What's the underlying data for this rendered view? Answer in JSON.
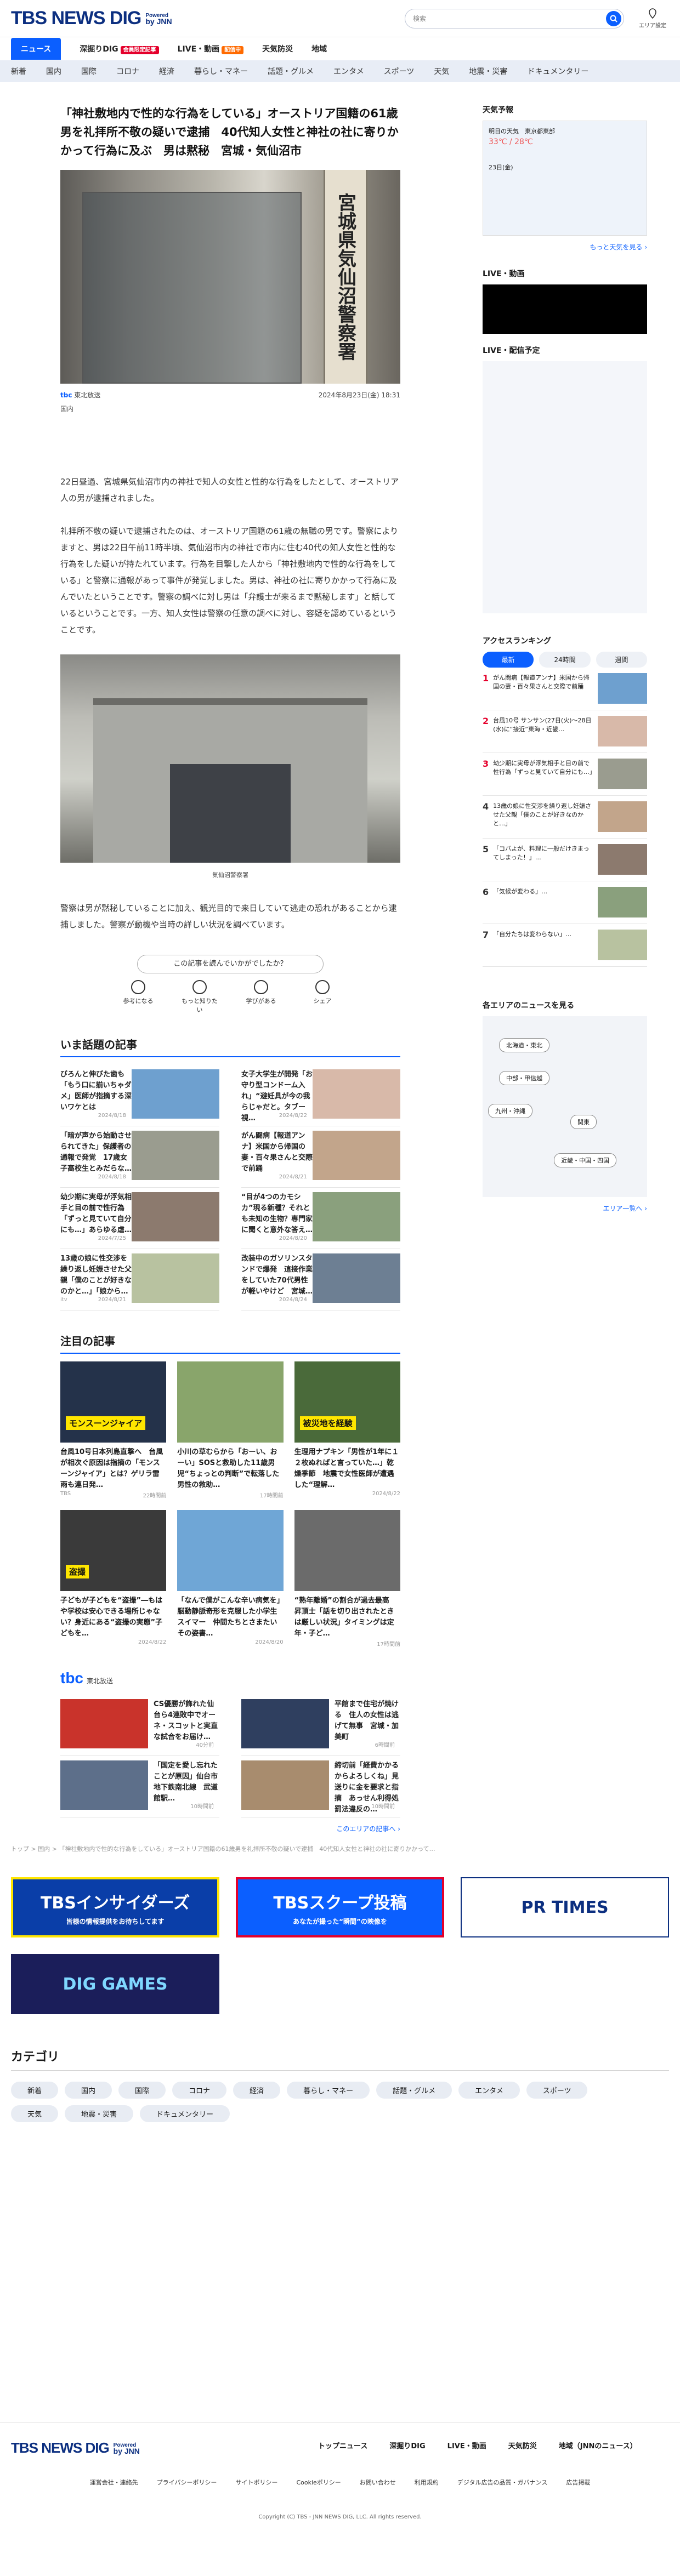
{
  "header": {
    "logo": "TBS NEWS DIG",
    "powered": "Powered",
    "powered_by": "by JNN",
    "search_placeholder": "検索",
    "area_label": "エリア設定"
  },
  "nav": {
    "items": [
      {
        "label": "ニュース",
        "tag": ""
      },
      {
        "label": "深掘りDIG",
        "tag": "会員限定記事"
      },
      {
        "label": "LIVE・動画",
        "tag": "配信中"
      },
      {
        "label": "天気防災",
        "tag": ""
      },
      {
        "label": "地域",
        "tag": ""
      }
    ]
  },
  "subnav": [
    "新着",
    "国内",
    "国際",
    "コロナ",
    "経済",
    "暮らし・マネー",
    "話題・グルメ",
    "エンタメ",
    "スポーツ",
    "天気",
    "地震・災害",
    "ドキュメンタリー"
  ],
  "article": {
    "title": "「神社敷地内で性的な行為をしている」オーストリア国籍の61歳男を礼拝所不敬の疑いで逮捕　40代知人女性と神社の社に寄りかかって行為に及ぶ　男は黙秘　宮城・気仙沼市",
    "sign_text": "宮城県気仙沼警察署",
    "source": "東北放送",
    "date": "2024年8月23日(金) 18:31",
    "category": "国内",
    "paragraphs": [
      "22日昼過、宮城県気仙沼市内の神社で知人の女性と性的な行為をしたとして、オーストリア人の男が逮捕されました。",
      "礼拝所不敬の疑いで逮捕されたのは、オーストリア国籍の61歳の無職の男です。警察によりますと、男は22日午前11時半頃、気仙沼市内の神社で市内に住む40代の知人女性と性的な行為をした疑いが持たれています。行為を目撃した人から「神社敷地内で性的な行為をしている」と警察に通報があって事件が発覚しました。男は、神社の社に寄りかかって行為に及んでいたということです。警察の調べに対し男は「弁護士が来るまで黙秘します」と話しているということです。一方、知人女性は警察の任意の調べに対し、容疑を認めているということです。",
      "警察は男が黙秘していることに加え、観光目的で来日していて逃走の恐れがあることから逮捕しました。警察が動機や当時の詳しい状況を調べています。"
    ],
    "photo2_caption": "気仙沼警察署"
  },
  "feedback": {
    "question": "この記事を読んでいかがでしたか？",
    "options": [
      "参考になる",
      "もっと知りたい",
      "学びがある",
      "シェア"
    ]
  },
  "trending": {
    "title": "いま話題の記事",
    "items": [
      {
        "text": "びろんと伸びた歯も「もう口に揃いちゃダメ」医師が指摘する深いワケとは",
        "src": "",
        "date": "2024/8/18"
      },
      {
        "text": "女子大学生が開発「お守り型コンドーム入れ」“避妊具が今の我らじゃだと。タブー視…",
        "src": "",
        "date": "2024/8/22"
      },
      {
        "text": "「暗が声から始動させられてきた」保護者の通報で発覚　17歳女子高校生とみだらな…",
        "src": "",
        "date": "2024/8/18"
      },
      {
        "text": "がん闘病【報道アンナ】米国から帰国の妻・百々果さんと交際で前踊",
        "src": "",
        "date": "2024/8/21"
      },
      {
        "text": "幼少期に実母が浮気相手と目の前で性行為「ずっと見ていて自分にも…」あらゆる虐…",
        "src": "",
        "date": "2024/7/25"
      },
      {
        "text": "“目が4つのカモシカ”現る新種？それとも未知の生物？専門家に聞くと意外な答え…",
        "src": "",
        "date": "2024/8/20"
      },
      {
        "text": "13歳の娘に性交渉を繰り返し妊娠させた父親「僕のことが好きなのかと…」「娘から…",
        "src": "itv",
        "date": "2024/8/21"
      },
      {
        "text": "改装中のガソリンスタンドで爆発　這接作業をしていた70代男性が軽いやけど　宮城…",
        "src": "",
        "date": "2024/8/24"
      }
    ]
  },
  "featured": {
    "title": "注目の記事",
    "items": [
      {
        "text": "台風10号日本列島直撃へ　台風が相次ぐ原因は指摘の「モンスーンジャイア」とは？ゲリラ雷雨も連日発…",
        "src": "TBS",
        "date": "22時間前",
        "img_text": "モンスーンジャイア"
      },
      {
        "text": "小川の草むらから「おーい、おーい」SOSと救助した11歳男児“ちょっとの判断”で転落した男性の救助…",
        "src": "",
        "date": "17時間前"
      },
      {
        "text": "生理用ナプキン「男性が1年に１２枚ぬればと言っていた…」乾燥季節　地震で女性医師が遭遇した“理解…",
        "src": "",
        "date": "2024/8/22",
        "img_text": "被災地を経験"
      },
      {
        "text": "子どもが子どもを“盗撮”―もはや学校は安心できる場所じゃない？身近にある“盗撮の実態”子どもを…",
        "src": "",
        "date": "2024/8/22",
        "img_text": "盗撮"
      },
      {
        "text": "「なんで僕がこんな辛い病気を」脳動静脈奇形を克服した小学生スイマー　仲間たちとさまたいその姿書…",
        "src": "",
        "date": "2024/8/20"
      },
      {
        "text": "“熟年離婚”の割合が過去最高　昇頂士「話を切り出されたときは厳しい状況」タイミングは定年・子ど…",
        "src": "",
        "date": "17時間前"
      }
    ]
  },
  "tbc": {
    "logo": "tbc",
    "label": "東北放送",
    "items": [
      {
        "text": "CS優勝が飾れた仙台ら4連敗中でオーネ・スコットと実直な試合をお届け…",
        "date": "40分前"
      },
      {
        "text": "平館まで住宅が焼ける　住人の女性は逃げて無事　宮城・加美町",
        "date": "6時間前"
      },
      {
        "text": "「国定を愛し忘れたことが原因」仙台市地下鉄南北線　武道館駅…",
        "date": "10時間前"
      },
      {
        "text": "締切前「経費かかるからよろしくね」見送りに金を要求と指摘　あっせん利得処罰法違反の…",
        "date": "10時間前"
      }
    ],
    "more": "このエリアの記事へ ›"
  },
  "sidebar": {
    "weather_title": "天気予報",
    "weather_card": "明日の天気　東京都東部",
    "weather_temp": "33℃ / 28℃",
    "weather_date": "23日(金)",
    "weather_more": "もっと天気を見る ›",
    "live_title": "LIVE・動画",
    "live_sched": "LIVE・配信予定",
    "rank_title": "アクセスランキング",
    "rank_tabs": [
      "最新",
      "24時間",
      "週間"
    ],
    "rank_items": [
      "がん闘病【報道アンナ】米国から帰国の妻・百々果さんと交際で前踊",
      "台風10号 サンサン(27日(火)～28日(水)に“接近”東海・近畿…",
      "幼少期に実母が浮気相手と目の前で性行為「ずっと見ていて自分にも…」",
      "13歳の娘に性交渉を繰り返し妊娠させた父親「僕のことが好きなのかと…」",
      "「コバよが、料理に一般だけきまってしまった！」…",
      "「気候が変わる」…",
      "「自分たちは変わらない」…"
    ],
    "area_title": "各エリアのニュースを見る",
    "areas": [
      "北海道・東北",
      "中部・甲信越",
      "九州・沖縄",
      "関東",
      "近畿・中国・四国"
    ],
    "area_more": "エリア一覧へ ›"
  },
  "banners": [
    {
      "label": "TBSインサイダーズ",
      "sub": "皆様の情報提供をお待ちしてます"
    },
    {
      "label": "TBSスクープ投稿",
      "sub": "あなたが撮った“瞬間”の映像を"
    },
    {
      "label": "PR TIMES",
      "sub": ""
    },
    {
      "label": "DIG GAMES",
      "sub": ""
    }
  ],
  "breadcrumb": "トップ > 国内 > 「神社敷地内で性的な行為をしている」オーストリア国籍の61歳男を礼拝所不敬の疑いで逮捕　40代知人女性と神社の社に寄りかかって…",
  "categories": {
    "title": "カテゴリ",
    "items": [
      "新着",
      "国内",
      "国際",
      "コロナ",
      "経済",
      "暮らし・マネー",
      "話題・グルメ",
      "エンタメ",
      "スポーツ",
      "天気",
      "地震・災害",
      "ドキュメンタリー"
    ]
  },
  "footer": {
    "links": [
      "トップニュース",
      "深掘りDIG",
      "LIVE・動画",
      "天気防災",
      "地域（JNNのニュース）"
    ],
    "links2": [
      "運営会社・連絡先",
      "プライバシーポリシー",
      "サイトポリシー",
      "Cookieポリシー",
      "お問い合わせ",
      "利用規約",
      "デジタル広告の品質・ガバナンス",
      "広告掲載"
    ],
    "copyright": "Copyright (C) TBS - JNN NEWS DIG, LLC. All rights reserved."
  }
}
